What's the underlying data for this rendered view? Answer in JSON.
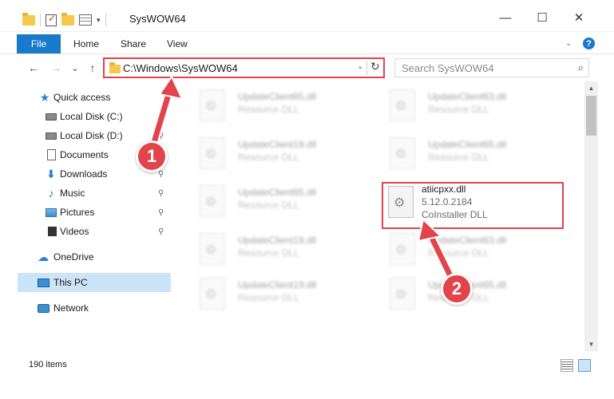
{
  "window": {
    "title": "SysWOW64",
    "minimize_glyph": "—",
    "maximize_glyph": "☐",
    "close_glyph": "✕"
  },
  "quick_access_toolbar": {
    "caret": "▾"
  },
  "ribbon": {
    "tabs": [
      {
        "label": "File",
        "active": true
      },
      {
        "label": "Home"
      },
      {
        "label": "Share"
      },
      {
        "label": "View"
      }
    ],
    "expand_glyph": "⌄",
    "help_glyph": "?"
  },
  "navigation": {
    "back_glyph": "←",
    "forward_glyph": "→",
    "recent_glyph": "⌄",
    "up_glyph": "↑",
    "address": "C:\\Windows\\SysWOW64",
    "address_dropdown_glyph": "⌄",
    "refresh_glyph": "↻",
    "search_placeholder": "Search SysWOW64",
    "search_icon": "search-icon"
  },
  "sidebar": {
    "items": [
      {
        "label": "Quick access",
        "icon": "star-icon",
        "pinned": false
      },
      {
        "label": "Local Disk (C:)",
        "icon": "drive-icon",
        "pinned": true
      },
      {
        "label": "Local Disk (D:)",
        "icon": "drive-icon",
        "pinned": true
      },
      {
        "label": "Documents",
        "icon": "documents-icon",
        "pinned": true
      },
      {
        "label": "Downloads",
        "icon": "downloads-icon",
        "pinned": true
      },
      {
        "label": "Music",
        "icon": "music-icon",
        "pinned": true
      },
      {
        "label": "Pictures",
        "icon": "pictures-icon",
        "pinned": true
      },
      {
        "label": "Videos",
        "icon": "videos-icon",
        "pinned": true
      },
      {
        "label": "OneDrive",
        "icon": "onedrive-icon",
        "pinned": false
      },
      {
        "label": "This PC",
        "icon": "this-pc-icon",
        "selected": true
      },
      {
        "label": "Network",
        "icon": "network-icon",
        "pinned": false
      }
    ],
    "pin_glyph": "📌"
  },
  "files": {
    "left": [
      {
        "name": "UpdateClient65.dll",
        "type": "Resource DLL"
      },
      {
        "name": "UpdateClient19.dll",
        "type": "Resource DLL"
      },
      {
        "name": "UpdateClient65.dll",
        "type": "Resource DLL"
      },
      {
        "name": "UpdateClient19.dll",
        "type": "Resource DLL"
      },
      {
        "name": "UpdateClient19.dll",
        "type": "Resource DLL"
      }
    ],
    "right": [
      {
        "name": "UpdateClient63.dll",
        "type": "Resource DLL"
      },
      {
        "name": "UpdateClient65.dll",
        "type": "Resource DLL"
      },
      {
        "name": "atiicpxx.dll",
        "version": "5.12.0.2184",
        "type": "CoInstaller DLL",
        "highlighted": true
      },
      {
        "name": "UpdateClient63.dll",
        "type": "Resource DLL"
      },
      {
        "name": "UpdateClient65.dll",
        "type": "Resource DLL"
      }
    ]
  },
  "status": {
    "item_count": "190 items"
  },
  "scrollbar": {
    "up_glyph": "▲",
    "down_glyph": "▼"
  },
  "annotations": {
    "callout_1": "1",
    "callout_2": "2"
  },
  "colors": {
    "accent": "#1979ca",
    "highlight_red": "#e3434b",
    "selection": "#cce4f7"
  }
}
